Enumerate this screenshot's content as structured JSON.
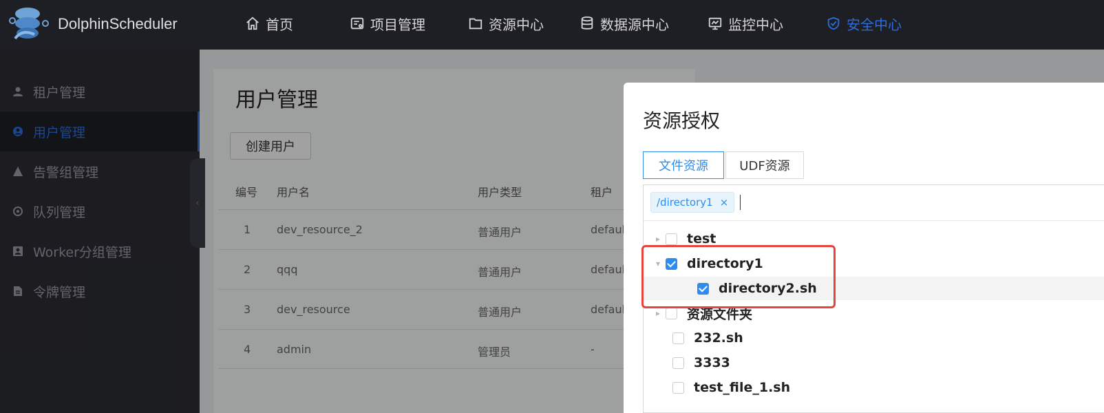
{
  "app": {
    "brand": "DolphinScheduler"
  },
  "nav": {
    "items": [
      {
        "label": "首页",
        "icon": "home-icon"
      },
      {
        "label": "项目管理",
        "icon": "project-icon"
      },
      {
        "label": "资源中心",
        "icon": "folder-icon"
      },
      {
        "label": "数据源中心",
        "icon": "database-icon"
      },
      {
        "label": "监控中心",
        "icon": "monitor-icon"
      },
      {
        "label": "安全中心",
        "icon": "shield-icon",
        "active": true
      }
    ]
  },
  "sidebar": {
    "items": [
      {
        "label": "租户管理",
        "icon": "user-icon"
      },
      {
        "label": "用户管理",
        "icon": "user-circle-icon",
        "active": true
      },
      {
        "label": "告警组管理",
        "icon": "warning-icon"
      },
      {
        "label": "队列管理",
        "icon": "queue-icon"
      },
      {
        "label": "Worker分组管理",
        "icon": "worker-icon"
      },
      {
        "label": "令牌管理",
        "icon": "token-icon"
      }
    ],
    "collapse_symbol": "‹"
  },
  "page": {
    "title": "用户管理",
    "create_button": "创建用户",
    "table": {
      "headers": [
        "编号",
        "用户名",
        "用户类型",
        "租户"
      ],
      "rows": [
        {
          "id": "1",
          "name": "dev_resource_2",
          "type": "普通用户",
          "tenant": "defaul"
        },
        {
          "id": "2",
          "name": "qqq",
          "type": "普通用户",
          "tenant": "defaul"
        },
        {
          "id": "3",
          "name": "dev_resource",
          "type": "普通用户",
          "tenant": "defaul"
        },
        {
          "id": "4",
          "name": "admin",
          "type": "管理员",
          "tenant": "-"
        }
      ]
    }
  },
  "modal": {
    "title": "资源授权",
    "tabs": [
      {
        "label": "文件资源",
        "active": true
      },
      {
        "label": "UDF资源",
        "active": false
      }
    ],
    "selected_tag": "/directory1",
    "tag_close": "×",
    "tree": [
      {
        "label": "test",
        "checked": false,
        "expandable": true,
        "expanded": false
      },
      {
        "label": "directory1",
        "checked": true,
        "expandable": true,
        "expanded": true
      },
      {
        "label": "directory2.sh",
        "checked": true,
        "expandable": false,
        "child": true
      },
      {
        "label": "资源文件夹",
        "checked": false,
        "expandable": true,
        "expanded": false
      },
      {
        "label": "232.sh",
        "checked": false,
        "expandable": false
      },
      {
        "label": "3333",
        "checked": false,
        "expandable": false
      },
      {
        "label": "test_file_1.sh",
        "checked": false,
        "expandable": false
      }
    ]
  },
  "colors": {
    "accent": "#2d8cf0",
    "nav_active": "#2d6cdf",
    "highlight_box": "#e5443d"
  }
}
